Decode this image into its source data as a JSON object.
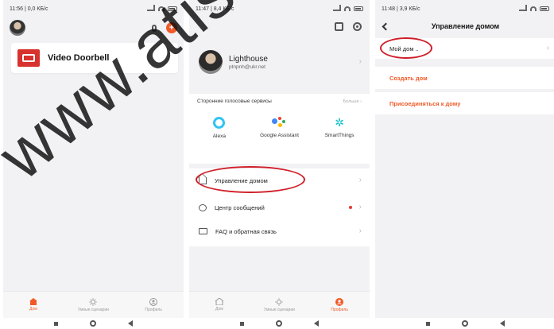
{
  "panel1": {
    "status": "11:56 | 0,0 КБ/с",
    "device": {
      "name": "Video Doorbell",
      "icon": "doorbell-device-icon"
    },
    "icons": [
      "microphone-icon",
      "add-plus-icon"
    ]
  },
  "panel2": {
    "status": "11:47 | 8,4 КБ/с",
    "profile": {
      "name": "Lighthouse",
      "email": "ptnpnh@ukr.net"
    },
    "voice": {
      "title": "Сторонние голосовые сервисы",
      "more": "Больше",
      "items": [
        {
          "label": "Alexa",
          "icon": "alexa-icon"
        },
        {
          "label": "Google Assistant",
          "icon": "google-assistant-icon"
        },
        {
          "label": "SmartThings",
          "icon": "smartthings-icon"
        }
      ]
    },
    "menu": [
      {
        "label": "Управление домом",
        "icon": "home-icon"
      },
      {
        "label": "Центр сообщений",
        "icon": "message-icon"
      },
      {
        "label": "FAQ и обратная связь",
        "icon": "faq-icon"
      }
    ]
  },
  "panel3": {
    "status": "11:48 | 3,9 КБ/с",
    "title": "Управление домом",
    "home_item": "Мой дом ..",
    "create_home": "Создать дом",
    "join_home": "Присоединяться к дому"
  },
  "nav": [
    {
      "label": "Дом",
      "icon": "home-nav-icon"
    },
    {
      "label": "Умные сценарии",
      "icon": "smart-scenes-icon"
    },
    {
      "label": "Профиль",
      "icon": "profile-nav-icon"
    }
  ],
  "colors": {
    "accent": "#f05a28",
    "highlight": "#d0202a"
  },
  "watermark": "www.atis-"
}
